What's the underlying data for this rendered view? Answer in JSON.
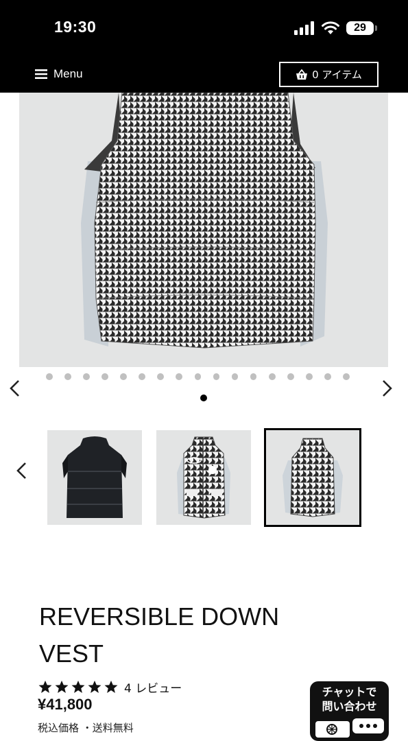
{
  "status_bar": {
    "time": "19:30",
    "battery": "29",
    "icons": [
      "signal-icon",
      "wifi-icon",
      "battery-icon"
    ]
  },
  "header": {
    "menu_label": "Menu",
    "cart_label": "0 アイテム",
    "background": "#000000"
  },
  "gallery": {
    "total_dots": 17,
    "active_index": 0,
    "icons": [
      "chevron-left-icon",
      "chevron-right-icon"
    ]
  },
  "thumbnails": {
    "items": [
      {
        "variant": "black-back",
        "selected": false
      },
      {
        "variant": "houndstooth-front",
        "selected": false
      },
      {
        "variant": "houndstooth-back",
        "selected": true
      }
    ]
  },
  "product": {
    "title_line1": "REVERSIBLE DOWN",
    "title_line2": "VEST",
    "rating": 5,
    "review_label": "4 レビュー",
    "price": "¥41,800",
    "tax_note": "税込価格 ・送料無料"
  },
  "chat_badge": {
    "line1": "チャットで",
    "line2": "問い合わせ"
  }
}
